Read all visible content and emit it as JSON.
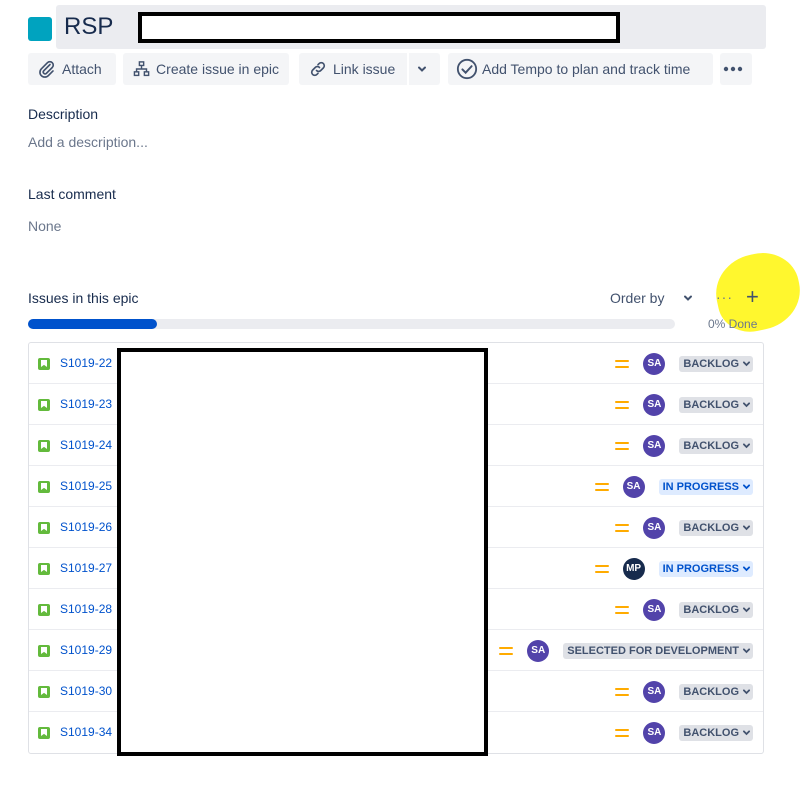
{
  "issue": {
    "project_prefix": "RSP",
    "color": "#00a3bf"
  },
  "toolbar": {
    "attach_label": "Attach",
    "create_issue_label": "Create issue in epic",
    "link_issue_label": "Link issue",
    "tempo_label": "Add Tempo to plan and track time"
  },
  "description": {
    "label": "Description",
    "placeholder": "Add a description..."
  },
  "last_comment": {
    "label": "Last comment",
    "value": "None"
  },
  "epic": {
    "title": "Issues in this epic",
    "order_by_label": "Order by",
    "more_label": "···",
    "add_label": "+",
    "progress_percent": 20,
    "progress_label": "0% Done"
  },
  "issues": [
    {
      "key": "S1019-22",
      "avatar": "SA",
      "avatar_color": "#5243aa",
      "status": "BACKLOG",
      "status_kind": "backlog"
    },
    {
      "key": "S1019-23",
      "avatar": "SA",
      "avatar_color": "#5243aa",
      "status": "BACKLOG",
      "status_kind": "backlog"
    },
    {
      "key": "S1019-24",
      "avatar": "SA",
      "avatar_color": "#5243aa",
      "status": "BACKLOG",
      "status_kind": "backlog"
    },
    {
      "key": "S1019-25",
      "avatar": "SA",
      "avatar_color": "#5243aa",
      "status": "IN PROGRESS",
      "status_kind": "progress"
    },
    {
      "key": "S1019-26",
      "avatar": "SA",
      "avatar_color": "#5243aa",
      "status": "BACKLOG",
      "status_kind": "backlog"
    },
    {
      "key": "S1019-27",
      "avatar": "MP",
      "avatar_color": "#172b4d",
      "status": "IN PROGRESS",
      "status_kind": "progress"
    },
    {
      "key": "S1019-28",
      "avatar": "SA",
      "avatar_color": "#5243aa",
      "status": "BACKLOG",
      "status_kind": "backlog"
    },
    {
      "key": "S1019-29",
      "avatar": "SA",
      "avatar_color": "#5243aa",
      "status": "SELECTED FOR DEVELOPMENT",
      "status_kind": "selected"
    },
    {
      "key": "S1019-30",
      "avatar": "SA",
      "avatar_color": "#5243aa",
      "status": "BACKLOG",
      "status_kind": "backlog"
    },
    {
      "key": "S1019-34",
      "avatar": "SA",
      "avatar_color": "#5243aa",
      "status": "BACKLOG",
      "status_kind": "backlog"
    }
  ]
}
